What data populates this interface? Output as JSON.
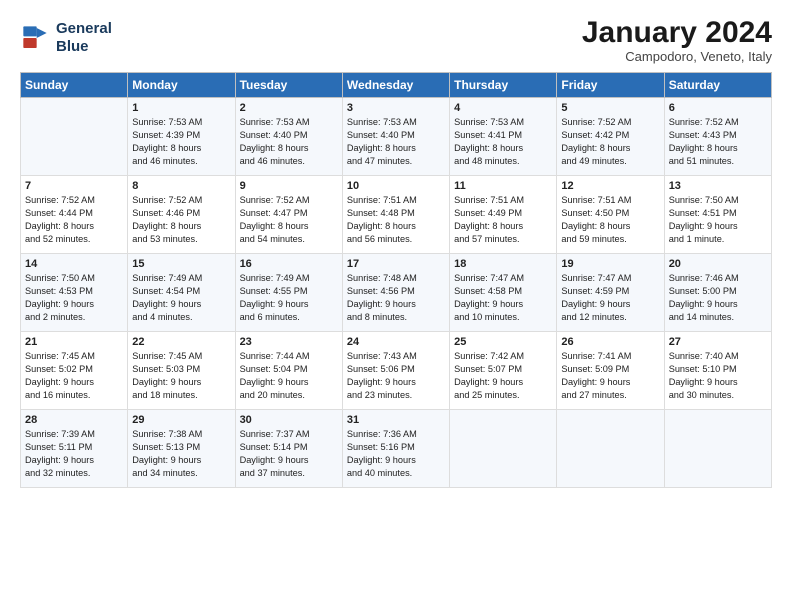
{
  "header": {
    "logo_line1": "General",
    "logo_line2": "Blue",
    "month_title": "January 2024",
    "location": "Campodoro, Veneto, Italy"
  },
  "weekdays": [
    "Sunday",
    "Monday",
    "Tuesday",
    "Wednesday",
    "Thursday",
    "Friday",
    "Saturday"
  ],
  "weeks": [
    [
      {
        "day": "",
        "lines": []
      },
      {
        "day": "1",
        "lines": [
          "Sunrise: 7:53 AM",
          "Sunset: 4:39 PM",
          "Daylight: 8 hours",
          "and 46 minutes."
        ]
      },
      {
        "day": "2",
        "lines": [
          "Sunrise: 7:53 AM",
          "Sunset: 4:40 PM",
          "Daylight: 8 hours",
          "and 46 minutes."
        ]
      },
      {
        "day": "3",
        "lines": [
          "Sunrise: 7:53 AM",
          "Sunset: 4:40 PM",
          "Daylight: 8 hours",
          "and 47 minutes."
        ]
      },
      {
        "day": "4",
        "lines": [
          "Sunrise: 7:53 AM",
          "Sunset: 4:41 PM",
          "Daylight: 8 hours",
          "and 48 minutes."
        ]
      },
      {
        "day": "5",
        "lines": [
          "Sunrise: 7:52 AM",
          "Sunset: 4:42 PM",
          "Daylight: 8 hours",
          "and 49 minutes."
        ]
      },
      {
        "day": "6",
        "lines": [
          "Sunrise: 7:52 AM",
          "Sunset: 4:43 PM",
          "Daylight: 8 hours",
          "and 51 minutes."
        ]
      }
    ],
    [
      {
        "day": "7",
        "lines": [
          "Sunrise: 7:52 AM",
          "Sunset: 4:44 PM",
          "Daylight: 8 hours",
          "and 52 minutes."
        ]
      },
      {
        "day": "8",
        "lines": [
          "Sunrise: 7:52 AM",
          "Sunset: 4:46 PM",
          "Daylight: 8 hours",
          "and 53 minutes."
        ]
      },
      {
        "day": "9",
        "lines": [
          "Sunrise: 7:52 AM",
          "Sunset: 4:47 PM",
          "Daylight: 8 hours",
          "and 54 minutes."
        ]
      },
      {
        "day": "10",
        "lines": [
          "Sunrise: 7:51 AM",
          "Sunset: 4:48 PM",
          "Daylight: 8 hours",
          "and 56 minutes."
        ]
      },
      {
        "day": "11",
        "lines": [
          "Sunrise: 7:51 AM",
          "Sunset: 4:49 PM",
          "Daylight: 8 hours",
          "and 57 minutes."
        ]
      },
      {
        "day": "12",
        "lines": [
          "Sunrise: 7:51 AM",
          "Sunset: 4:50 PM",
          "Daylight: 8 hours",
          "and 59 minutes."
        ]
      },
      {
        "day": "13",
        "lines": [
          "Sunrise: 7:50 AM",
          "Sunset: 4:51 PM",
          "Daylight: 9 hours",
          "and 1 minute."
        ]
      }
    ],
    [
      {
        "day": "14",
        "lines": [
          "Sunrise: 7:50 AM",
          "Sunset: 4:53 PM",
          "Daylight: 9 hours",
          "and 2 minutes."
        ]
      },
      {
        "day": "15",
        "lines": [
          "Sunrise: 7:49 AM",
          "Sunset: 4:54 PM",
          "Daylight: 9 hours",
          "and 4 minutes."
        ]
      },
      {
        "day": "16",
        "lines": [
          "Sunrise: 7:49 AM",
          "Sunset: 4:55 PM",
          "Daylight: 9 hours",
          "and 6 minutes."
        ]
      },
      {
        "day": "17",
        "lines": [
          "Sunrise: 7:48 AM",
          "Sunset: 4:56 PM",
          "Daylight: 9 hours",
          "and 8 minutes."
        ]
      },
      {
        "day": "18",
        "lines": [
          "Sunrise: 7:47 AM",
          "Sunset: 4:58 PM",
          "Daylight: 9 hours",
          "and 10 minutes."
        ]
      },
      {
        "day": "19",
        "lines": [
          "Sunrise: 7:47 AM",
          "Sunset: 4:59 PM",
          "Daylight: 9 hours",
          "and 12 minutes."
        ]
      },
      {
        "day": "20",
        "lines": [
          "Sunrise: 7:46 AM",
          "Sunset: 5:00 PM",
          "Daylight: 9 hours",
          "and 14 minutes."
        ]
      }
    ],
    [
      {
        "day": "21",
        "lines": [
          "Sunrise: 7:45 AM",
          "Sunset: 5:02 PM",
          "Daylight: 9 hours",
          "and 16 minutes."
        ]
      },
      {
        "day": "22",
        "lines": [
          "Sunrise: 7:45 AM",
          "Sunset: 5:03 PM",
          "Daylight: 9 hours",
          "and 18 minutes."
        ]
      },
      {
        "day": "23",
        "lines": [
          "Sunrise: 7:44 AM",
          "Sunset: 5:04 PM",
          "Daylight: 9 hours",
          "and 20 minutes."
        ]
      },
      {
        "day": "24",
        "lines": [
          "Sunrise: 7:43 AM",
          "Sunset: 5:06 PM",
          "Daylight: 9 hours",
          "and 23 minutes."
        ]
      },
      {
        "day": "25",
        "lines": [
          "Sunrise: 7:42 AM",
          "Sunset: 5:07 PM",
          "Daylight: 9 hours",
          "and 25 minutes."
        ]
      },
      {
        "day": "26",
        "lines": [
          "Sunrise: 7:41 AM",
          "Sunset: 5:09 PM",
          "Daylight: 9 hours",
          "and 27 minutes."
        ]
      },
      {
        "day": "27",
        "lines": [
          "Sunrise: 7:40 AM",
          "Sunset: 5:10 PM",
          "Daylight: 9 hours",
          "and 30 minutes."
        ]
      }
    ],
    [
      {
        "day": "28",
        "lines": [
          "Sunrise: 7:39 AM",
          "Sunset: 5:11 PM",
          "Daylight: 9 hours",
          "and 32 minutes."
        ]
      },
      {
        "day": "29",
        "lines": [
          "Sunrise: 7:38 AM",
          "Sunset: 5:13 PM",
          "Daylight: 9 hours",
          "and 34 minutes."
        ]
      },
      {
        "day": "30",
        "lines": [
          "Sunrise: 7:37 AM",
          "Sunset: 5:14 PM",
          "Daylight: 9 hours",
          "and 37 minutes."
        ]
      },
      {
        "day": "31",
        "lines": [
          "Sunrise: 7:36 AM",
          "Sunset: 5:16 PM",
          "Daylight: 9 hours",
          "and 40 minutes."
        ]
      },
      {
        "day": "",
        "lines": []
      },
      {
        "day": "",
        "lines": []
      },
      {
        "day": "",
        "lines": []
      }
    ]
  ]
}
